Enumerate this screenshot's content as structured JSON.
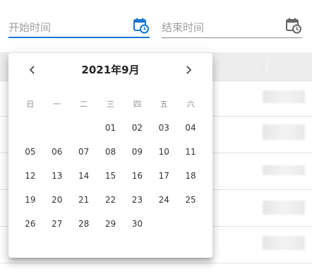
{
  "date_range": {
    "start_placeholder": "开始时间",
    "end_placeholder": "结束时间",
    "active_color": "#1976d2",
    "icon": "calendar-clock-icon"
  },
  "calendar": {
    "month_title": "2021年9月",
    "weekdays": [
      "日",
      "一",
      "二",
      "三",
      "四",
      "五",
      "六"
    ],
    "weeks": [
      [
        "",
        "",
        "",
        "01",
        "02",
        "03",
        "04"
      ],
      [
        "05",
        "06",
        "07",
        "08",
        "09",
        "10",
        "11"
      ],
      [
        "12",
        "13",
        "14",
        "15",
        "16",
        "17",
        "18"
      ],
      [
        "19",
        "20",
        "21",
        "22",
        "23",
        "24",
        "25"
      ],
      [
        "26",
        "27",
        "28",
        "29",
        "30",
        "",
        ""
      ]
    ],
    "prev_icon": "chevron-left-icon",
    "next_icon": "chevron-right-icon"
  }
}
